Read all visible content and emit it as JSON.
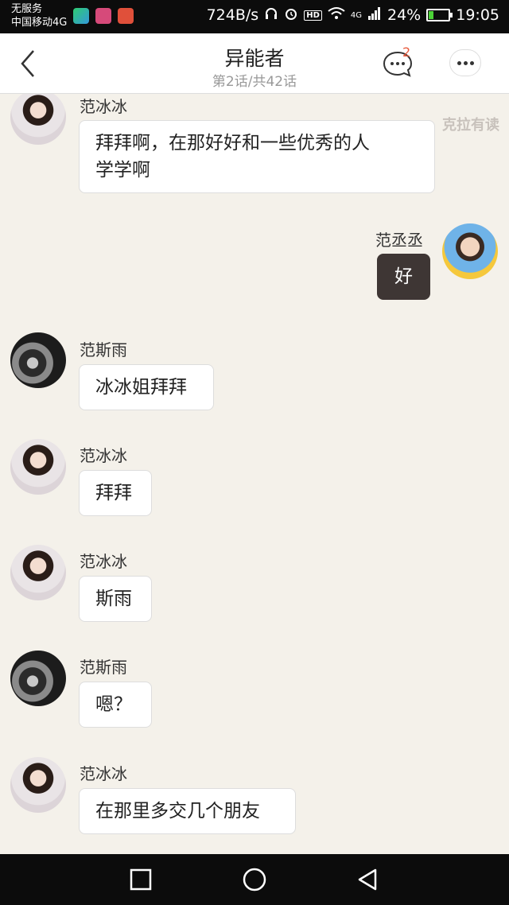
{
  "status_bar": {
    "carrier_line1": "无服务",
    "carrier_line2": "中国移动4G",
    "net_speed": "724B/s",
    "hd": "HD",
    "network_type": "4G",
    "battery": "24%",
    "battery_level": 0.24,
    "time": "19:05",
    "app_icons": [
      "video-app-icon",
      "lolo-app-icon",
      "mail-app-icon"
    ]
  },
  "header": {
    "title": "异能者",
    "subtitle": "第2话/共42话",
    "comment_count": "2"
  },
  "watermark": "克拉有读",
  "messages": [
    {
      "sender": "范冰冰",
      "side": "left",
      "avatar": "bingbing",
      "text_lines": [
        "拜拜啊，在那好好和一些优秀的人",
        "学学啊"
      ]
    },
    {
      "sender": "范丞丞",
      "side": "right",
      "avatar": "chengcheng",
      "text": "好"
    },
    {
      "sender": "范斯雨",
      "side": "left",
      "avatar": "siyu",
      "text": "冰冰姐拜拜"
    },
    {
      "sender": "范冰冰",
      "side": "left",
      "avatar": "bingbing",
      "text": "拜拜"
    },
    {
      "sender": "范冰冰",
      "side": "left",
      "avatar": "bingbing",
      "text": "斯雨"
    },
    {
      "sender": "范斯雨",
      "side": "left",
      "avatar": "siyu",
      "text": "嗯？"
    },
    {
      "sender": "范冰冰",
      "side": "left",
      "avatar": "bingbing",
      "text": "在那里多交几个朋友"
    }
  ],
  "colors": {
    "chat_background": "#f4f1ea",
    "self_bubble": "#3e3634",
    "badge": "#e85a3c"
  }
}
